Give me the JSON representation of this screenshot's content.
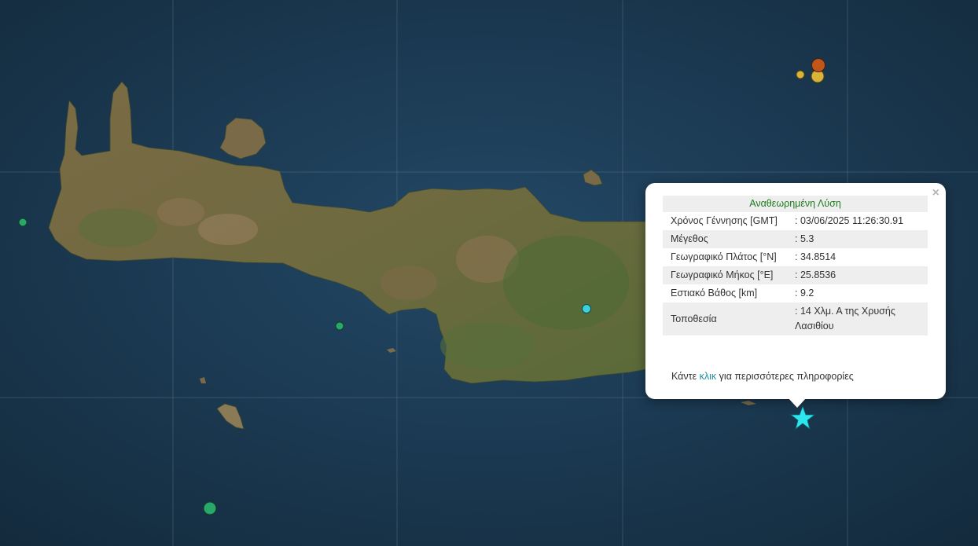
{
  "popup": {
    "title": "Αναθεωρημένη Λύση",
    "rows": [
      {
        "label": "Χρόνος Γέννησης [GMT]",
        "value": ": 03/06/2025 11:26:30.91"
      },
      {
        "label": "Μέγεθος",
        "value": ": 5.3"
      },
      {
        "label": "Γεωγραφικό Πλάτος [°N]",
        "value": ": 34.8514"
      },
      {
        "label": "Γεωγραφικό Μήκος [°E]",
        "value": ": 25.8536"
      },
      {
        "label": "Εστιακό Βάθος [km]",
        "value": ": 9.2"
      },
      {
        "label": "Τοποθεσία",
        "value": ": 14 Χλμ. Α της Χρυσής Λασιθίου"
      }
    ],
    "more_prefix": "Κάντε",
    "more_link": "κλικ",
    "more_suffix": "για περισσότερες πληροφορίες",
    "close_symbol": "×"
  },
  "colors": {
    "sea": "#1a3a52",
    "land": "#6f6a43",
    "mountain": "#8b6d49",
    "forest": "#4f6a35",
    "marker_green": "#2aa86a",
    "marker_cyan": "#3fcfd6",
    "marker_yellow": "#d9b43a",
    "marker_orange": "#c1561a",
    "star": "#2ee6f0",
    "popup_title": "#1e7b1e"
  }
}
